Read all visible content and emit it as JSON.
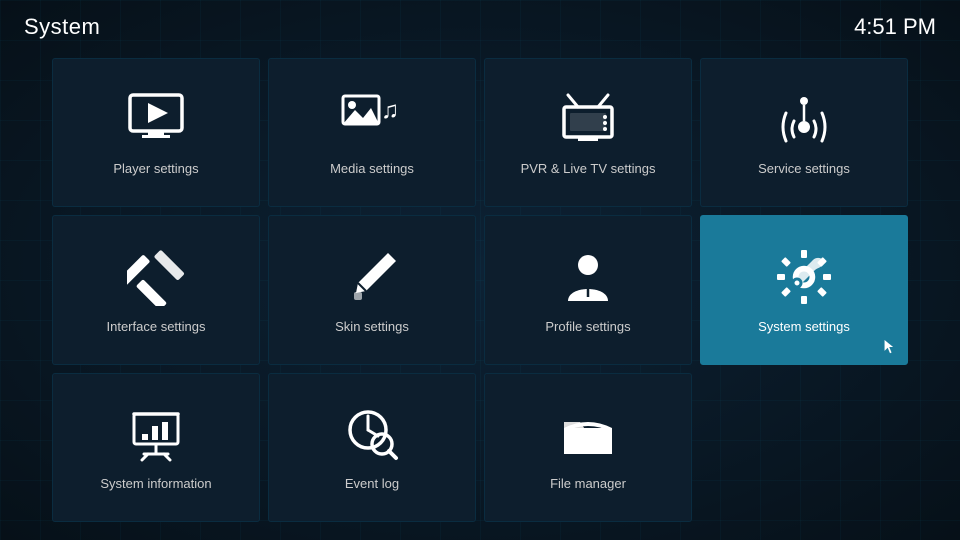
{
  "header": {
    "title": "System",
    "time": "4:51 PM"
  },
  "grid": {
    "items": [
      {
        "id": "player-settings",
        "label": "Player settings",
        "icon": "player",
        "active": false
      },
      {
        "id": "media-settings",
        "label": "Media settings",
        "icon": "media",
        "active": false
      },
      {
        "id": "pvr-settings",
        "label": "PVR & Live TV settings",
        "icon": "pvr",
        "active": false
      },
      {
        "id": "service-settings",
        "label": "Service settings",
        "icon": "service",
        "active": false
      },
      {
        "id": "interface-settings",
        "label": "Interface settings",
        "icon": "interface",
        "active": false
      },
      {
        "id": "skin-settings",
        "label": "Skin settings",
        "icon": "skin",
        "active": false
      },
      {
        "id": "profile-settings",
        "label": "Profile settings",
        "icon": "profile",
        "active": false
      },
      {
        "id": "system-settings",
        "label": "System settings",
        "icon": "system",
        "active": true
      },
      {
        "id": "system-information",
        "label": "System information",
        "icon": "sysinfo",
        "active": false
      },
      {
        "id": "event-log",
        "label": "Event log",
        "icon": "eventlog",
        "active": false
      },
      {
        "id": "file-manager",
        "label": "File manager",
        "icon": "filemanager",
        "active": false
      },
      {
        "id": "empty",
        "label": "",
        "icon": "empty",
        "active": false
      }
    ]
  }
}
